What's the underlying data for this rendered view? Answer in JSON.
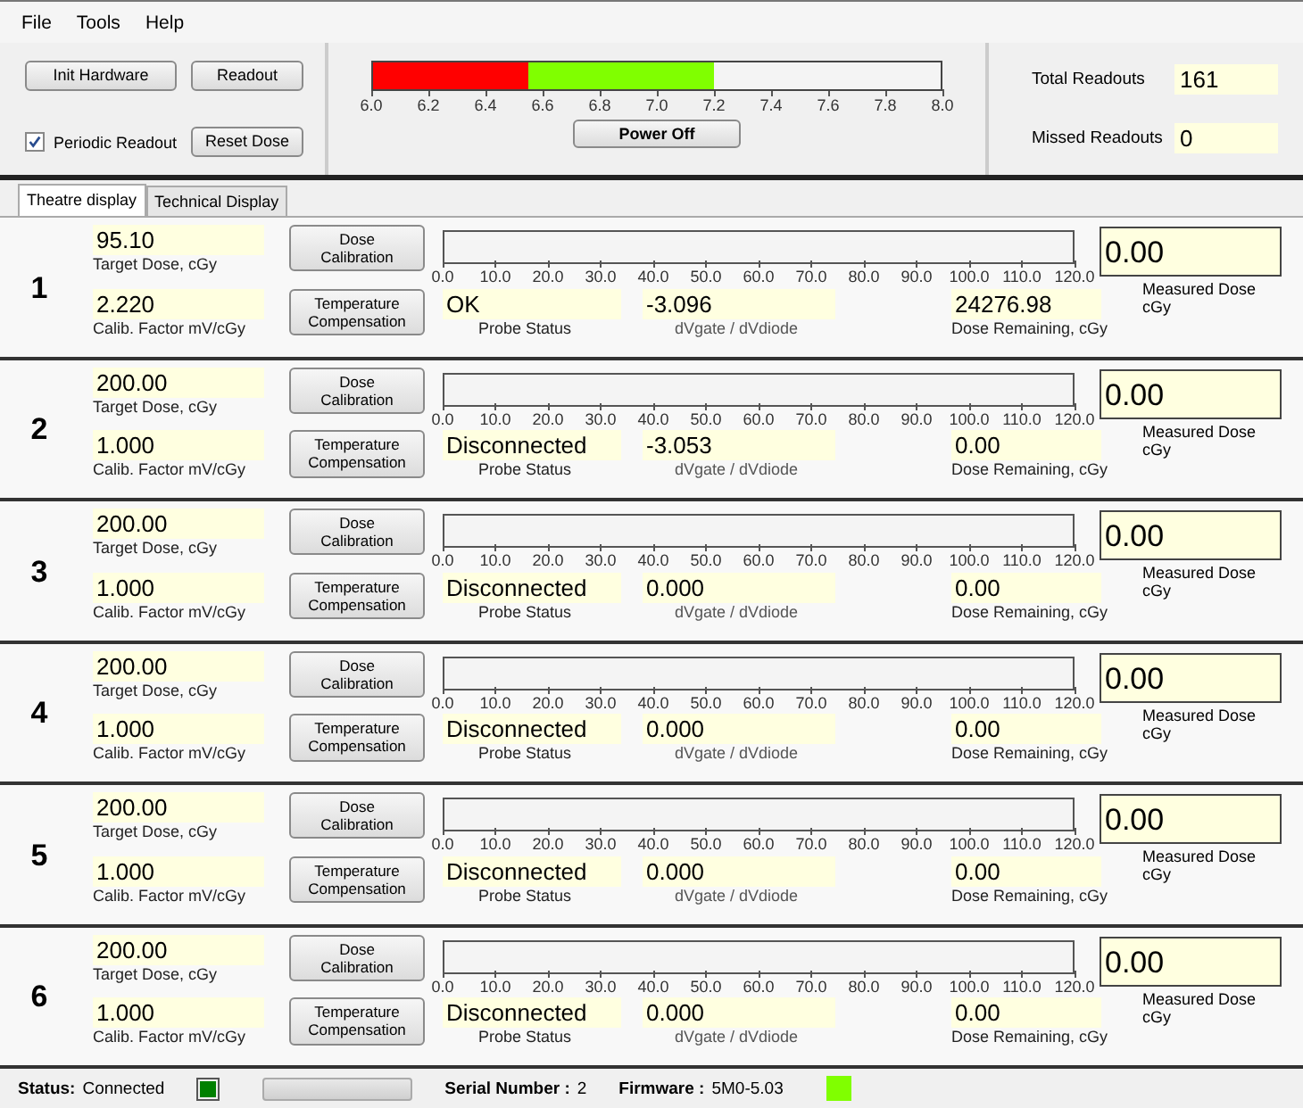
{
  "menu": [
    "File",
    "Tools",
    "Help"
  ],
  "controls": {
    "buttons": [
      "Init Hardware",
      "Readout",
      "Reset Dose"
    ],
    "periodic_readout": {
      "label": "Periodic Readout",
      "checked": true
    }
  },
  "power_meter": {
    "segments": [
      {
        "color": "#ff0000",
        "level": 0.275
      },
      {
        "color": "#80ff00",
        "level": 0.6
      }
    ],
    "ticks": [
      "6.0",
      "6.2",
      "6.4",
      "6.6",
      "6.8",
      "7.0",
      "7.2",
      "7.4",
      "7.6",
      "7.8",
      "8.0"
    ],
    "button": "Power Off"
  },
  "counters": [
    {
      "label": "Total Readouts",
      "value": "161"
    },
    {
      "label": "Missed Readouts",
      "value": "0"
    }
  ],
  "tabs": [
    {
      "label": "Theatre display",
      "selected": true
    },
    {
      "label": "Technical Display",
      "selected": false
    }
  ],
  "channels": [
    {
      "number": "1",
      "target_dose": "95.10",
      "target_label": "Target Dose, cGy",
      "calib_factor": "2.220",
      "calib_label": "Calib. Factor mV/cGy",
      "dose_button": "Dose\nCalibration",
      "temp_button": "Temperature\nCompensation",
      "ticks": [
        "0.0",
        "10.0",
        "20.0",
        "30.0",
        "40.0",
        "50.0",
        "60.0",
        "70.0",
        "80.0",
        "90.0",
        "100.0",
        "110.0",
        "120.0"
      ],
      "probe_status": "OK",
      "probe_label": "Probe Status",
      "dv": "-3.096",
      "dv_label": "dVgate / dVdiode",
      "dose_remaining": "24276.98",
      "remaining_label": "Dose Remaining, cGy",
      "measured": "0.00",
      "measured_label": "Measured Dose\ncGy"
    },
    {
      "number": "2",
      "target_dose": "200.00",
      "target_label": "Target Dose, cGy",
      "calib_factor": "1.000",
      "calib_label": "Calib. Factor mV/cGy",
      "dose_button": "Dose\nCalibration",
      "temp_button": "Temperature\nCompensation",
      "ticks": [
        "0.0",
        "10.0",
        "20.0",
        "30.0",
        "40.0",
        "50.0",
        "60.0",
        "70.0",
        "80.0",
        "90.0",
        "100.0",
        "110.0",
        "120.0"
      ],
      "probe_status": "Disconnected",
      "probe_label": "Probe Status",
      "dv": "-3.053",
      "dv_label": "dVgate / dVdiode",
      "dose_remaining": "0.00",
      "remaining_label": "Dose Remaining, cGy",
      "measured": "0.00",
      "measured_label": "Measured Dose\ncGy"
    },
    {
      "number": "3",
      "target_dose": "200.00",
      "target_label": "Target Dose, cGy",
      "calib_factor": "1.000",
      "calib_label": "Calib. Factor mV/cGy",
      "dose_button": "Dose\nCalibration",
      "temp_button": "Temperature\nCompensation",
      "ticks": [
        "0.0",
        "10.0",
        "20.0",
        "30.0",
        "40.0",
        "50.0",
        "60.0",
        "70.0",
        "80.0",
        "90.0",
        "100.0",
        "110.0",
        "120.0"
      ],
      "probe_status": "Disconnected",
      "probe_label": "Probe Status",
      "dv": "0.000",
      "dv_label": "dVgate / dVdiode",
      "dose_remaining": "0.00",
      "remaining_label": "Dose Remaining, cGy",
      "measured": "0.00",
      "measured_label": "Measured Dose\ncGy"
    },
    {
      "number": "4",
      "target_dose": "200.00",
      "target_label": "Target Dose, cGy",
      "calib_factor": "1.000",
      "calib_label": "Calib. Factor mV/cGy",
      "dose_button": "Dose\nCalibration",
      "temp_button": "Temperature\nCompensation",
      "ticks": [
        "0.0",
        "10.0",
        "20.0",
        "30.0",
        "40.0",
        "50.0",
        "60.0",
        "70.0",
        "80.0",
        "90.0",
        "100.0",
        "110.0",
        "120.0"
      ],
      "probe_status": "Disconnected",
      "probe_label": "Probe Status",
      "dv": "0.000",
      "dv_label": "dVgate / dVdiode",
      "dose_remaining": "0.00",
      "remaining_label": "Dose Remaining, cGy",
      "measured": "0.00",
      "measured_label": "Measured Dose\ncGy"
    },
    {
      "number": "5",
      "target_dose": "200.00",
      "target_label": "Target Dose, cGy",
      "calib_factor": "1.000",
      "calib_label": "Calib. Factor mV/cGy",
      "dose_button": "Dose\nCalibration",
      "temp_button": "Temperature\nCompensation",
      "ticks": [
        "0.0",
        "10.0",
        "20.0",
        "30.0",
        "40.0",
        "50.0",
        "60.0",
        "70.0",
        "80.0",
        "90.0",
        "100.0",
        "110.0",
        "120.0"
      ],
      "probe_status": "Disconnected",
      "probe_label": "Probe Status",
      "dv": "0.000",
      "dv_label": "dVgate / dVdiode",
      "dose_remaining": "0.00",
      "remaining_label": "Dose Remaining, cGy",
      "measured": "0.00",
      "measured_label": "Measured Dose\ncGy"
    },
    {
      "number": "6",
      "target_dose": "200.00",
      "target_label": "Target Dose, cGy",
      "calib_factor": "1.000",
      "calib_label": "Calib. Factor mV/cGy",
      "dose_button": "Dose\nCalibration",
      "temp_button": "Temperature\nCompensation",
      "ticks": [
        "0.0",
        "10.0",
        "20.0",
        "30.0",
        "40.0",
        "50.0",
        "60.0",
        "70.0",
        "80.0",
        "90.0",
        "100.0",
        "110.0",
        "120.0"
      ],
      "probe_status": "Disconnected",
      "probe_label": "Probe Status",
      "dv": "0.000",
      "dv_label": "dVgate / dVdiode",
      "dose_remaining": "0.00",
      "remaining_label": "Dose Remaining, cGy",
      "measured": "0.00",
      "measured_label": "Measured Dose\ncGy"
    }
  ],
  "status_bar": {
    "status_label": "Status:",
    "status": "Connected",
    "progress": {
      "level": 0
    },
    "serial_label": "Serial Number :",
    "serial": "2",
    "firmware_label": "Firmware :",
    "firmware": "5M0-5.03"
  }
}
